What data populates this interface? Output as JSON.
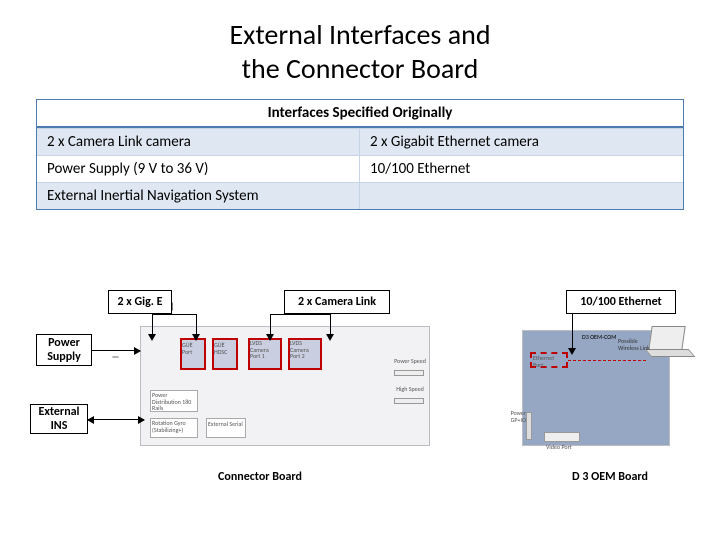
{
  "title": {
    "line1": "External Interfaces and",
    "line2": "the Connector Board"
  },
  "table": {
    "header": "Interfaces Specified Originally",
    "rows": [
      [
        "2 x Camera Link camera",
        "2 x Gigabit Ethernet camera"
      ],
      [
        "Power Supply (9 V to 36 V)",
        "10/100 Ethernet"
      ],
      [
        "External Inertial Navigation System",
        ""
      ]
    ]
  },
  "diagram": {
    "labels": {
      "gige": "2 x Gig. E",
      "camlink": "2 x Camera Link",
      "ethernet": "10/100 Ethernet",
      "power_supply": "Power Supply",
      "external_ins": "External INS",
      "connector_board": "Connector Board",
      "d3_board": "D 3 OEM Board"
    },
    "ports": {
      "p1": "GŪĒ Port",
      "p2": "GŪĒ HDSC",
      "p3": "LVDS Camera Port 1",
      "p4": "LVDS Camera Port 2",
      "eth": "Ethernet Port",
      "d3_label": "D3 OEM‑COM",
      "wifi": "Possible Wireless Link"
    },
    "blocks": {
      "power_dist": "Power Distribution 180 Rails",
      "gyro": "Rotation Gyro (Stabilizing+)",
      "serial": "External Serial",
      "power_speed": "Power Speed",
      "high_speed": "High Speed",
      "pwr_gp": "Power GP+IO",
      "video": "Video Port"
    }
  }
}
